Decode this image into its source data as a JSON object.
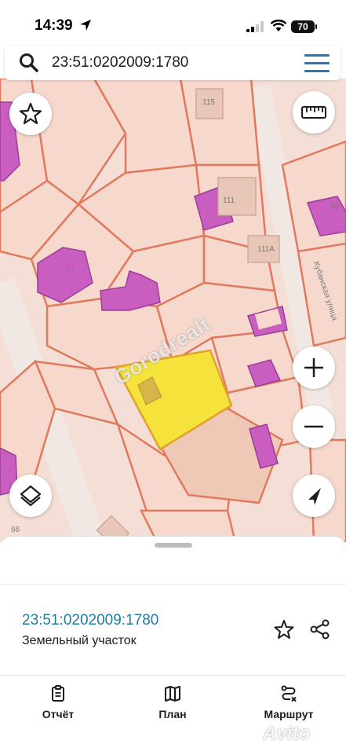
{
  "status_bar": {
    "time": "14:39",
    "battery": "70"
  },
  "search": {
    "query": "23:51:0202009:1780"
  },
  "map": {
    "house_numbers": [
      "115",
      "111",
      "96",
      "111А",
      "77",
      "66"
    ],
    "street_label": "Кубанская улица",
    "parcel_color": "#f5e33c",
    "building_color": "#c95dc0",
    "boundary_color": "#e07a5f"
  },
  "watermark": "Gorodrealt",
  "details": {
    "cadastral_number": "23:51:0202009:1780",
    "object_type": "Земельный участок"
  },
  "tabs": [
    {
      "label": "Отчёт",
      "icon": "report-icon"
    },
    {
      "label": "План",
      "icon": "map-plan-icon"
    },
    {
      "label": "Маршрут",
      "icon": "route-icon"
    }
  ],
  "avito_watermark": "Avito"
}
